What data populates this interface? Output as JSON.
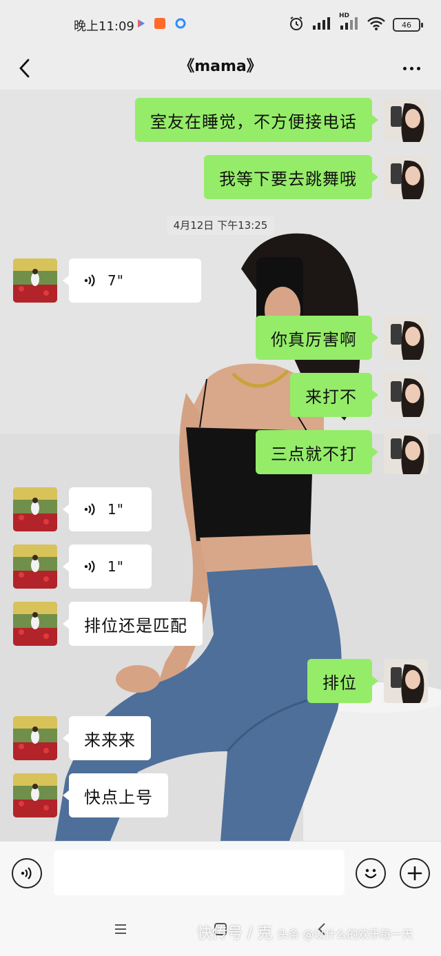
{
  "status_bar": {
    "time": "晚上11:09",
    "network": "HD",
    "battery": "46"
  },
  "header": {
    "title": "《mama》"
  },
  "timestamp": "4月12日 下午13:25",
  "messages": [
    {
      "from": "me",
      "text": "室友在睡觉，不方便接电话"
    },
    {
      "from": "me",
      "text": "我等下要去跳舞哦"
    },
    {
      "from": "mama",
      "type": "voice",
      "duration": "7\""
    },
    {
      "from": "me",
      "text": "你真厉害啊"
    },
    {
      "from": "me",
      "text": "来打不"
    },
    {
      "from": "me",
      "text": "三点就不打"
    },
    {
      "from": "mama",
      "type": "voice",
      "duration": "1\""
    },
    {
      "from": "mama",
      "type": "voice",
      "duration": "1\""
    },
    {
      "from": "mama",
      "text": "排位还是匹配"
    },
    {
      "from": "me",
      "text": "排位"
    },
    {
      "from": "mama",
      "text": "来来来"
    },
    {
      "from": "mama",
      "text": "快点上号"
    }
  ],
  "input": {
    "placeholder": ""
  },
  "watermark": {
    "main": "快传号 / 克",
    "sub": "头条 @以什么的欢乐每一天"
  },
  "colors": {
    "outgoing_bubble": "#95ec69",
    "incoming_bubble": "#ffffff",
    "background": "#ededed"
  },
  "icons": {
    "back": "chevron-left-icon",
    "more": "more-dots-icon",
    "voice": "voice-wave-icon",
    "emoji": "smiley-icon",
    "plus": "plus-circle-icon"
  }
}
